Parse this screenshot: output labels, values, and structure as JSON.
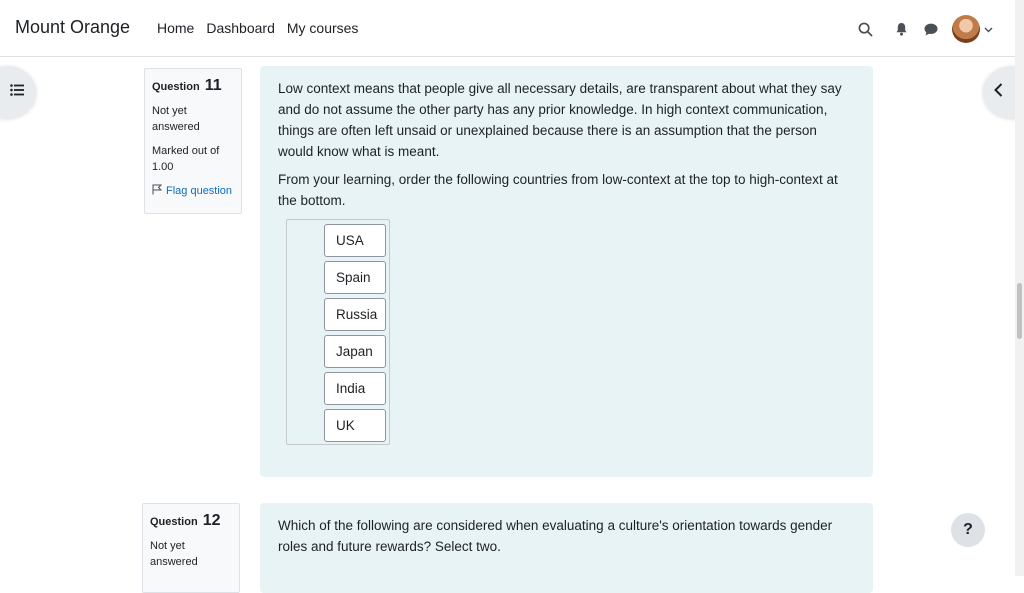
{
  "brand": "Mount Orange",
  "nav": {
    "home": "Home",
    "dashboard": "Dashboard",
    "my_courses": "My courses"
  },
  "questions": [
    {
      "label": "Question",
      "number": "11",
      "state_line1": "Not yet",
      "state_line2": "answered",
      "grade_line1": "Marked out of",
      "grade_line2": "1.00",
      "flag": "Flag question",
      "text1": "Low context means that people give all necessary details, are transparent about what they say and do not assume the other party has any prior knowledge. In high context communication, things are often left unsaid or unexplained because there is an assumption that the person would know what is meant.",
      "text2": "From your learning, order the following countries from low-context at the top to high-context at the bottom.",
      "items": [
        "USA",
        "Spain",
        "Russia",
        "Japan",
        "India",
        "UK"
      ]
    },
    {
      "label": "Question",
      "number": "12",
      "state_line1": "Not yet",
      "state_line2": "answered",
      "text1": "Which of the following are considered when evaluating a culture's orientation towards gender roles and future rewards? Select two."
    }
  ],
  "help": "?",
  "icons": {
    "search": "search-icon",
    "bell": "bell-icon",
    "chat": "chat-icon",
    "index": "list-icon",
    "chevron": "chevron-left-icon",
    "flag": "flag-icon"
  }
}
